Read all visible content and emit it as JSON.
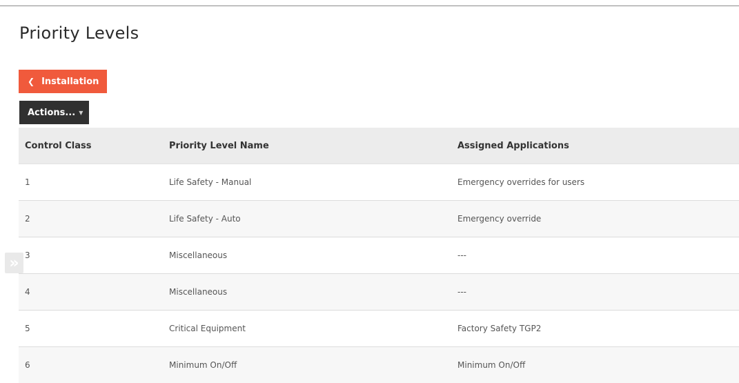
{
  "page": {
    "title": "Priority Levels"
  },
  "nav": {
    "back_label": "Installation",
    "back_icon": "chevron-left-icon"
  },
  "toolbar": {
    "actions_label": "Actions...",
    "actions_icon": "caret-down-icon"
  },
  "sidebar_toggle": {
    "icon": "double-chevron-right-icon"
  },
  "colors": {
    "accent": "#f05a3c",
    "dark_button": "#303030",
    "header_bg": "#ececec",
    "alt_row_bg": "#f7f7f7"
  },
  "table": {
    "columns": [
      "Control Class",
      "Priority Level Name",
      "Assigned Applications"
    ],
    "rows": [
      {
        "control_class": "1",
        "name": "Life Safety - Manual",
        "applications": "Emergency overrides for users"
      },
      {
        "control_class": "2",
        "name": "Life Safety - Auto",
        "applications": "Emergency override"
      },
      {
        "control_class": "3",
        "name": "Miscellaneous",
        "applications": "---"
      },
      {
        "control_class": "4",
        "name": "Miscellaneous",
        "applications": "---"
      },
      {
        "control_class": "5",
        "name": "Critical Equipment",
        "applications": "Factory Safety TGP2"
      },
      {
        "control_class": "6",
        "name": "Minimum On/Off",
        "applications": "Minimum On/Off"
      }
    ]
  }
}
